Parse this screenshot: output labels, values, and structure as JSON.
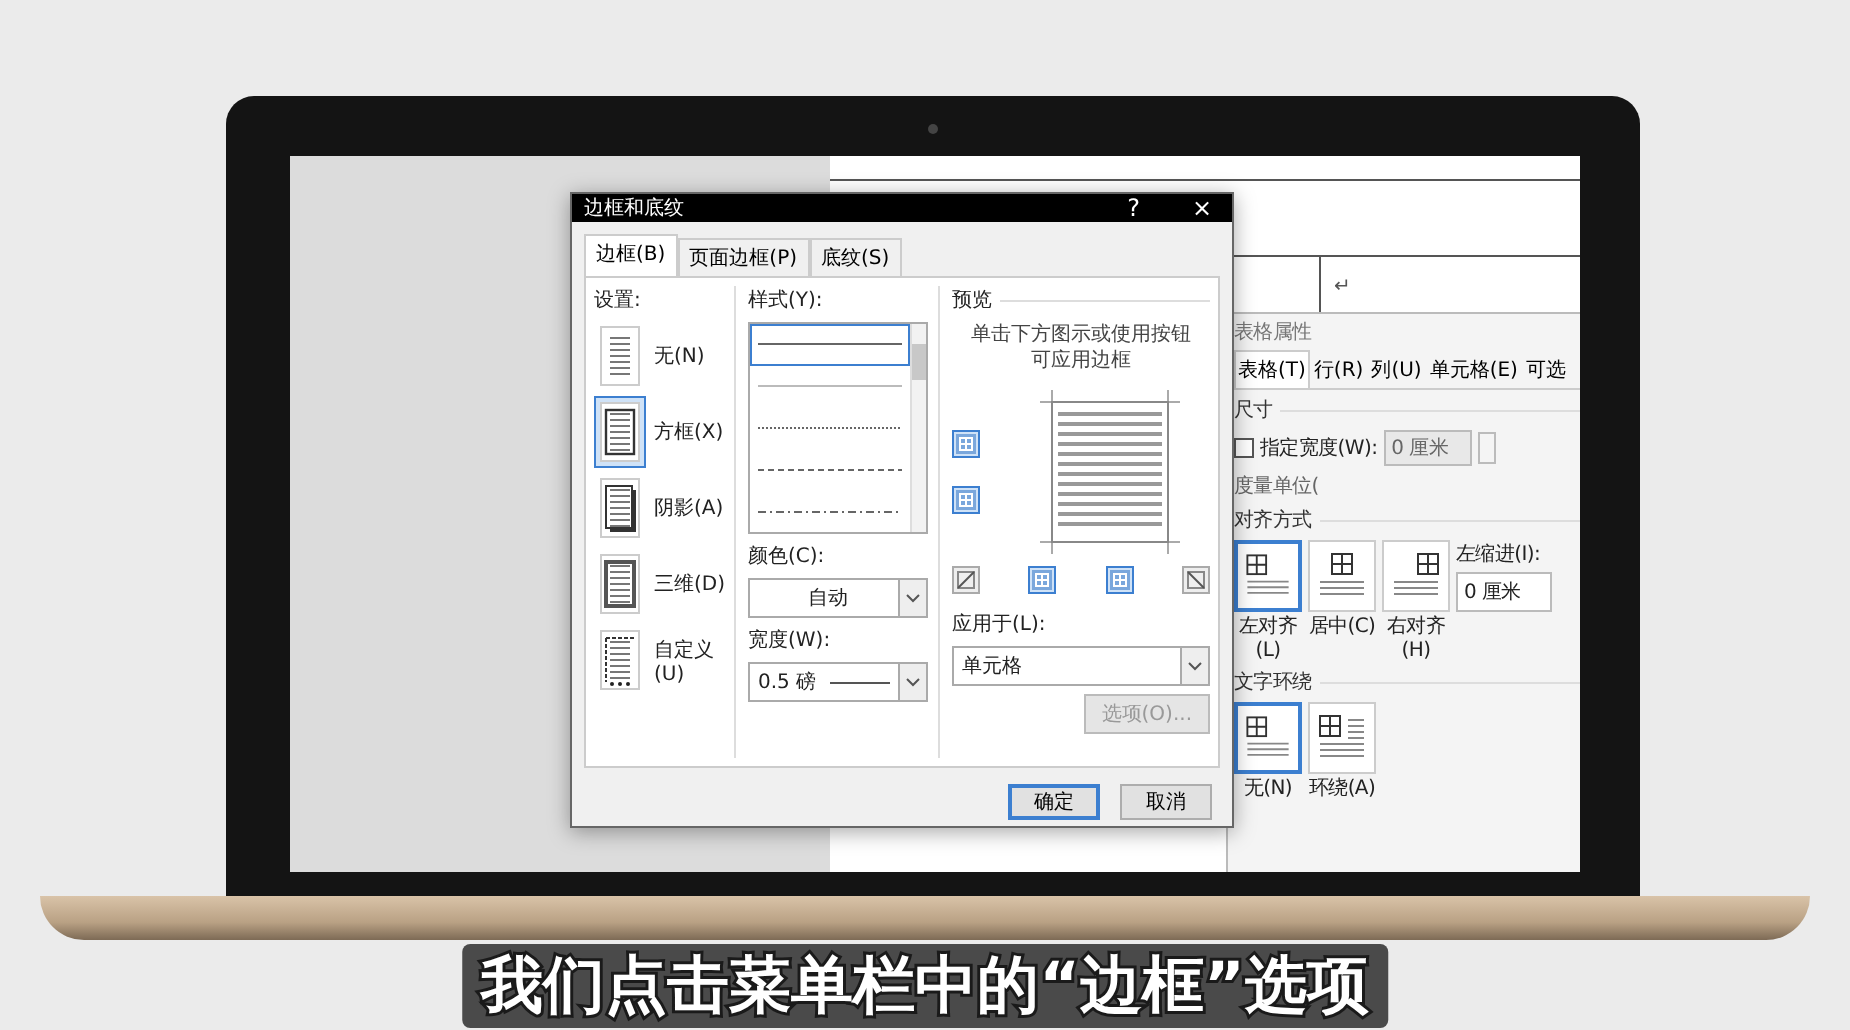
{
  "document": {
    "paragraph_mark": "↵"
  },
  "dialog": {
    "title": "边框和底纹",
    "help": "?",
    "close": "×",
    "tabs": [
      {
        "label": "边框(B)",
        "selected": true
      },
      {
        "label": "页面边框(P)",
        "selected": false
      },
      {
        "label": "底纹(S)",
        "selected": false
      }
    ],
    "settings": {
      "label": "设置:",
      "items": [
        {
          "label": "无(N)",
          "kind": "none",
          "selected": false
        },
        {
          "label": "方框(X)",
          "kind": "box",
          "selected": true
        },
        {
          "label": "阴影(A)",
          "kind": "shadow",
          "selected": false
        },
        {
          "label": "三维(D)",
          "kind": "threed",
          "selected": false
        },
        {
          "label": "自定义(U)",
          "kind": "custom",
          "selected": false
        }
      ]
    },
    "style": {
      "label": "样式(Y):",
      "lines": [
        {
          "kind": "solid",
          "selected": true
        },
        {
          "kind": "thin",
          "selected": false
        },
        {
          "kind": "dotted",
          "selected": false
        },
        {
          "kind": "dashed",
          "selected": false
        },
        {
          "kind": "dashdot",
          "selected": false
        }
      ]
    },
    "color": {
      "label": "颜色(C):",
      "value": "自动"
    },
    "width": {
      "label": "宽度(W):",
      "value": "0.5 磅"
    },
    "preview": {
      "label": "预览",
      "hint": "单击下方图示或使用按钮可应用边框",
      "side_buttons": [
        {
          "kind": "grid",
          "on": true
        },
        {
          "kind": "grid",
          "on": true
        }
      ],
      "bottom_buttons": [
        {
          "kind": "diagonal-up",
          "on": false
        },
        {
          "kind": "grid",
          "on": true
        },
        {
          "kind": "grid",
          "on": true
        },
        {
          "kind": "diagonal-down",
          "on": false
        }
      ],
      "apply_label": "应用于(L):",
      "apply_value": "单元格",
      "options": "选项(O)...",
      "options_disabled": true
    },
    "ok": "确定",
    "cancel": "取消"
  },
  "table_properties": {
    "title": "表格属性",
    "tabs": [
      {
        "label": "表格(T)",
        "selected": true
      },
      {
        "label": "行(R)",
        "selected": false
      },
      {
        "label": "列(U)",
        "selected": false
      },
      {
        "label": "单元格(E)",
        "selected": false
      },
      {
        "label": "可选",
        "selected": false
      }
    ],
    "size_label": "尺寸",
    "specify_width": {
      "label": "指定宽度(W):",
      "checked": false
    },
    "width_value": "0 厘米",
    "unit_label": "度量单位(",
    "alignment_label": "对齐方式",
    "alignments": [
      {
        "label": "左对齐(L)",
        "kind": "left",
        "selected": true
      },
      {
        "label": "居中(C)",
        "kind": "center",
        "selected": false
      },
      {
        "label": "右对齐(H)",
        "kind": "right",
        "selected": false
      }
    ],
    "indent_label": "左缩进(I):",
    "indent_value": "0 厘米",
    "wrap_label": "文字环绕",
    "wraps": [
      {
        "label": "无(N)",
        "kind": "none",
        "selected": true
      },
      {
        "label": "环绕(A)",
        "kind": "around",
        "selected": false
      }
    ]
  },
  "caption": "我们点击菜单栏中的“边框”选项"
}
